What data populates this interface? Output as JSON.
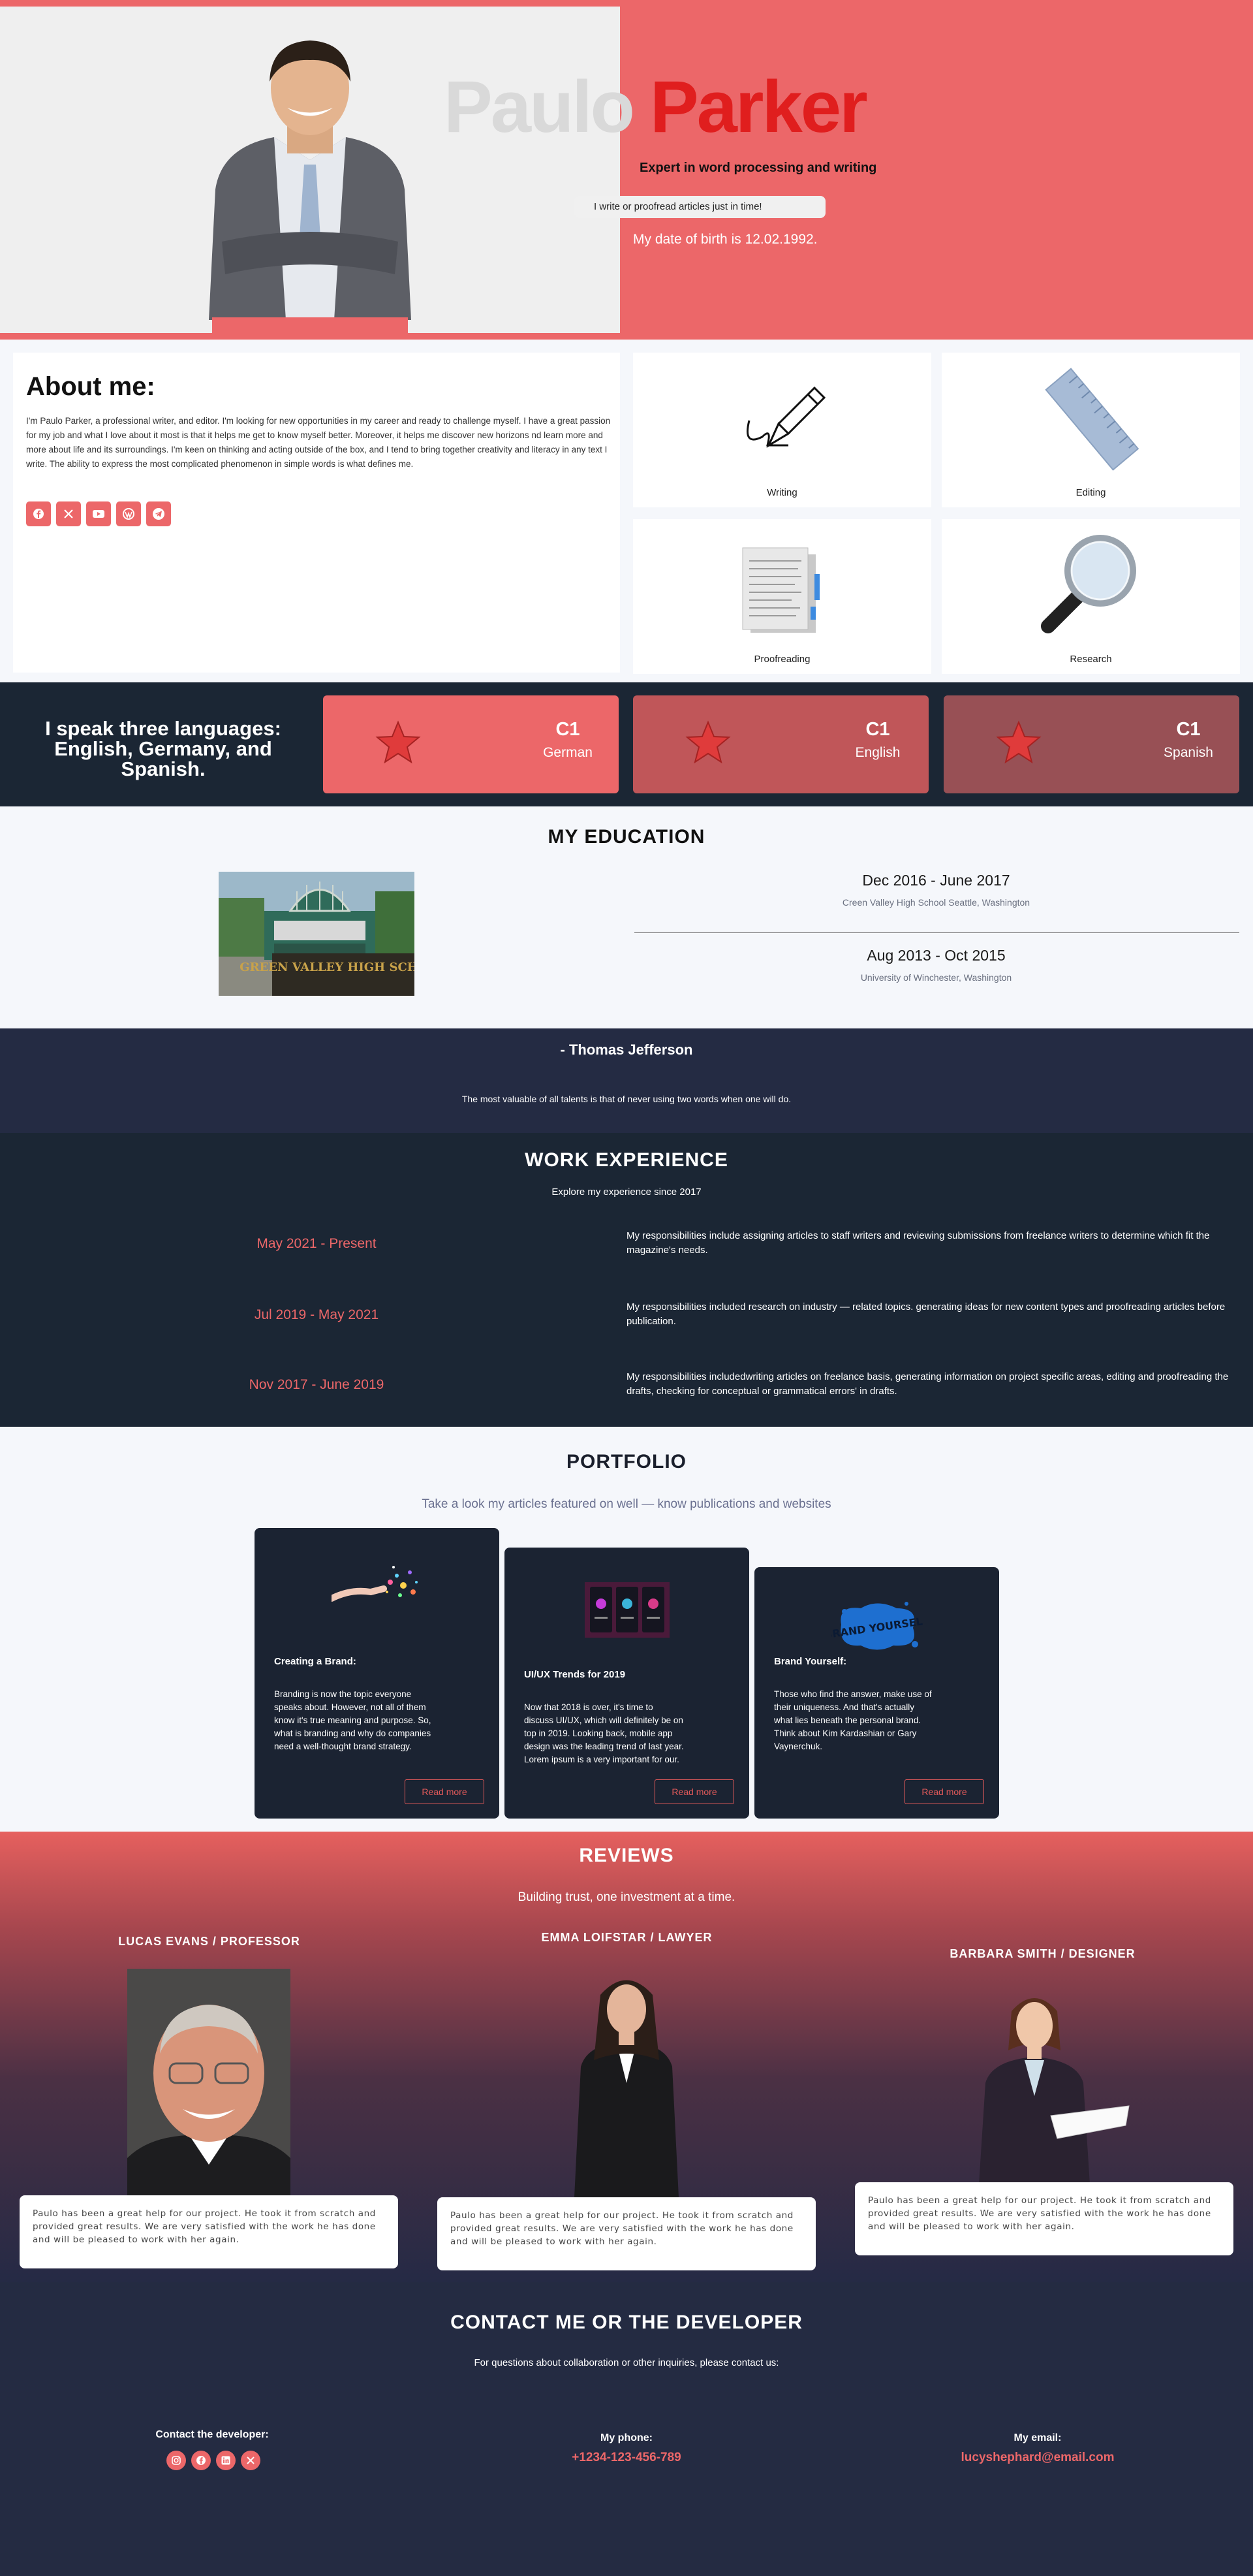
{
  "hero": {
    "first_name": "Paulo",
    "last_name": "Parker",
    "subtitle": "Expert in word processing and writing",
    "pill": "I write or proofread articles just in time!",
    "dob": "My date of birth is 12.02.1992."
  },
  "about": {
    "title": "About me:",
    "text": "I'm Paulo Parker, a professional writer, and editor. I'm looking for new opportunities in my career and ready to challenge myself. I have a great passion for my job and what I love about it most is that it helps me get to know myself better. Moreover, it helps me discover new horizons nd learn more and more about life and its surroundings. I'm keen on thinking and acting outside of the box, and I tend to bring together creativity and literacy in any text I write. The ability to express the most complicated phenomenon in simple words is what defines me.",
    "socials": [
      "facebook-icon",
      "x-icon",
      "youtube-icon",
      "wordpress-icon",
      "telegram-icon"
    ]
  },
  "skills": [
    {
      "label": "Writing",
      "icon": "pen-icon"
    },
    {
      "label": "Editing",
      "icon": "ruler-icon"
    },
    {
      "label": "Proofreading",
      "icon": "documents-icon"
    },
    {
      "label": "Research",
      "icon": "magnifier-icon"
    }
  ],
  "languages": {
    "intro": "I speak three languages: English, Germany, and Spanish.",
    "items": [
      {
        "level": "C1",
        "name": "German",
        "color": "#ec6769"
      },
      {
        "level": "C1",
        "name": "English",
        "color": "#c05659"
      },
      {
        "level": "C1",
        "name": "Spanish",
        "color": "#985055"
      }
    ]
  },
  "education": {
    "title": "MY EDUCATION",
    "photo_caption": "GREEN VALLEY HIGH SCHOOL",
    "items": [
      {
        "dates": "Dec 2016 - June 2017",
        "place": "Creen Valley High School Seattle, Washington"
      },
      {
        "dates": "Aug 2013 - Oct 2015",
        "place": "University of Winchester, Washington"
      }
    ]
  },
  "quote": {
    "author": "- Thomas Jefferson",
    "text": "The most valuable of all talents is that of never using two words when one will do."
  },
  "work": {
    "title": "WORK EXPERIENCE",
    "subtitle": "Explore my experience since 2017",
    "items": [
      {
        "dates": "May 2021 - Present",
        "desc": "My responsibilities include assigning articles to staff writers and reviewing submissions from freelance writers to determine which fit the magazine's needs."
      },
      {
        "dates": "Jul 2019 - May 2021",
        "desc": "My responsibilities included research on industry — related topics. generating ideas for new content types and proofreading articles before publication."
      },
      {
        "dates": "Nov 2017 - June 2019",
        "desc": "My responsibilities includedwriting articles on freelance basis, generating information on project specific areas, editing and proofreading the drafts, checking for conceptual or grammatical errors' in drafts."
      }
    ]
  },
  "portfolio": {
    "title": "PORTFOLIO",
    "subtitle": "Take a look my articles featured on well — know publications and websites",
    "items": [
      {
        "title": "Creating a Brand:",
        "body": "Branding is now the topic everyone speaks about. However, not all of them know it's true meaning and purpose. So, what is branding and why do companies need a well-thought brand strategy.",
        "button": "Read more"
      },
      {
        "title": "UI/UX Trends for 2019",
        "body": "Now that 2018 is over, it's time to discuss UI/UX, which will definitely be on top in 2019. Looking back, mobile app design was the leading trend of last year. Lorem ipsum is a very important for our.",
        "button": "Read more"
      },
      {
        "title": "Brand Yourself:",
        "body": "Those who find the answer, make use of their uniqueness. And that's actually what lies beneath the personal brand. Think about Kim Kardashian or Gary Vaynerchuk.",
        "button": "Read more"
      }
    ],
    "art_text": "BRAND YOURSELF"
  },
  "reviews": {
    "title": "REVIEWS",
    "subtitle": "Building trust, one investment at a time.",
    "items": [
      {
        "name": "LUCAS EVANS / PROFESSOR",
        "text": "Paulo has been a great help for our project. He took it from scratch and provided great results. We are very satisfied with the work he has done and will be pleased to work with her again."
      },
      {
        "name": "EMMA LOIFSTAR / LAWYER",
        "text": "Paulo has been a great help for our project. He took it from scratch and provided great results. We are very satisfied with the work he has done and will be pleased to work with her again."
      },
      {
        "name": "BARBARA SMITH / DESIGNER",
        "text": "Paulo has been a great help for our project. He took it from scratch and provided great results. We are very satisfied with the work he has done and will be pleased to work with her again."
      }
    ]
  },
  "contact": {
    "title": "CONTACT ME OR THE DEVELOPER",
    "subtitle": "For questions about collaboration or other inquiries, please contact us:",
    "developer_label": "Contact the developer:",
    "developer_icons": [
      "instagram-icon",
      "facebook-icon",
      "linkedin-icon",
      "x-icon"
    ],
    "phone_label": "My phone:",
    "phone": "+1234-123-456-789",
    "email_label": "My email:",
    "email": "lucyshephard@email.com"
  }
}
